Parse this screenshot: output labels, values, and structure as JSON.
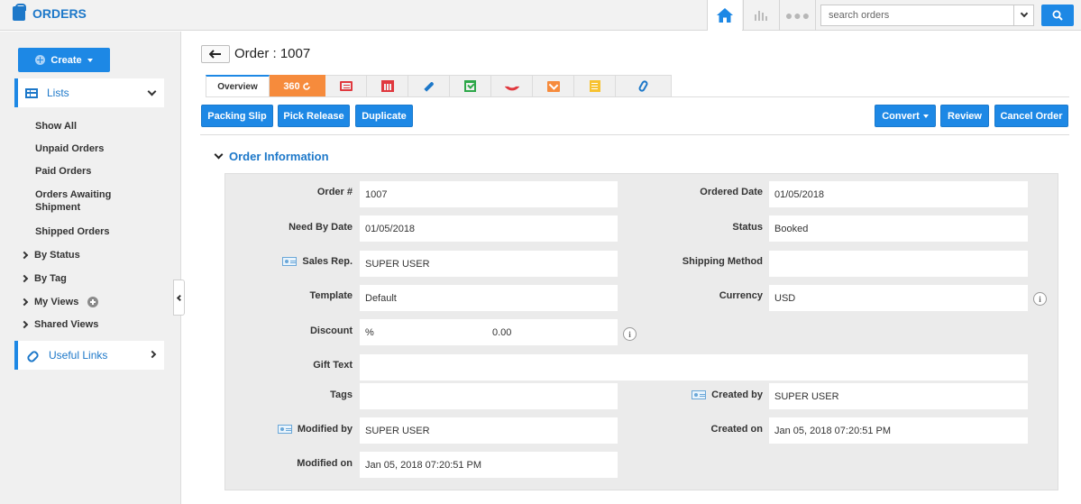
{
  "app": {
    "title": "ORDERS"
  },
  "topbar": {
    "search_placeholder": "search orders"
  },
  "sidebar": {
    "create_label": "Create",
    "lists_label": "Lists",
    "items": [
      "Show All",
      "Unpaid Orders",
      "Paid Orders",
      "Orders Awaiting Shipment",
      "Shipped Orders"
    ],
    "tree": [
      "By Status",
      "By Tag",
      "My Views",
      "Shared Views"
    ],
    "useful_links_label": "Useful Links"
  },
  "order": {
    "title": "Order : 1007",
    "tabs": {
      "overview": "Overview",
      "three60": "360"
    },
    "buttons": {
      "packing_slip": "Packing Slip",
      "pick_release": "Pick Release",
      "duplicate": "Duplicate",
      "convert": "Convert",
      "review": "Review",
      "cancel_order": "Cancel Order"
    }
  },
  "section": {
    "title": "Order Information"
  },
  "fields": {
    "order_no": {
      "label": "Order #",
      "value": "1007"
    },
    "ordered_date": {
      "label": "Ordered Date",
      "value": "01/05/2018"
    },
    "need_by_date": {
      "label": "Need By Date",
      "value": "01/05/2018"
    },
    "status": {
      "label": "Status",
      "value": "Booked"
    },
    "sales_rep": {
      "label": "Sales Rep.",
      "value": "SUPER USER"
    },
    "shipping_method": {
      "label": "Shipping Method",
      "value": ""
    },
    "template": {
      "label": "Template",
      "value": "Default"
    },
    "currency": {
      "label": "Currency",
      "value": "USD"
    },
    "discount": {
      "label": "Discount",
      "unit": "%",
      "value": "0.00"
    },
    "gift_text": {
      "label": "Gift Text",
      "value": ""
    },
    "tags": {
      "label": "Tags",
      "value": ""
    },
    "created_by": {
      "label": "Created by",
      "value": "SUPER USER"
    },
    "modified_by": {
      "label": "Modified by",
      "value": "SUPER USER"
    },
    "created_on": {
      "label": "Created on",
      "value": "Jan 05, 2018 07:20:51 PM"
    },
    "modified_on": {
      "label": "Modified on",
      "value": "Jan 05, 2018 07:20:51 PM"
    }
  },
  "colors": {
    "accent": "#1d88e5",
    "tab_360": "#f68b3c"
  }
}
